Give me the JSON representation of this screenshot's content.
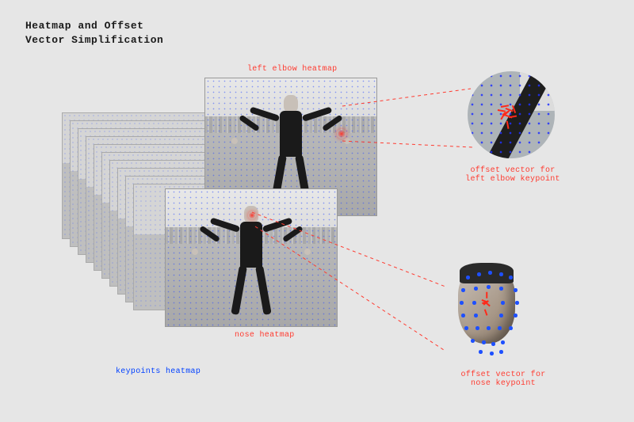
{
  "title": "Heatmap and Offset\nVector Simplification",
  "labels": {
    "left_elbow_heatmap": "left elbow heatmap",
    "nose_heatmap": "nose heatmap",
    "keypoints_heatmap": "keypoints heatmap",
    "offset_vector_left_elbow": "offset vector for\nleft elbow keypoint",
    "offset_vector_nose": "offset vector for\nnose keypoint"
  }
}
